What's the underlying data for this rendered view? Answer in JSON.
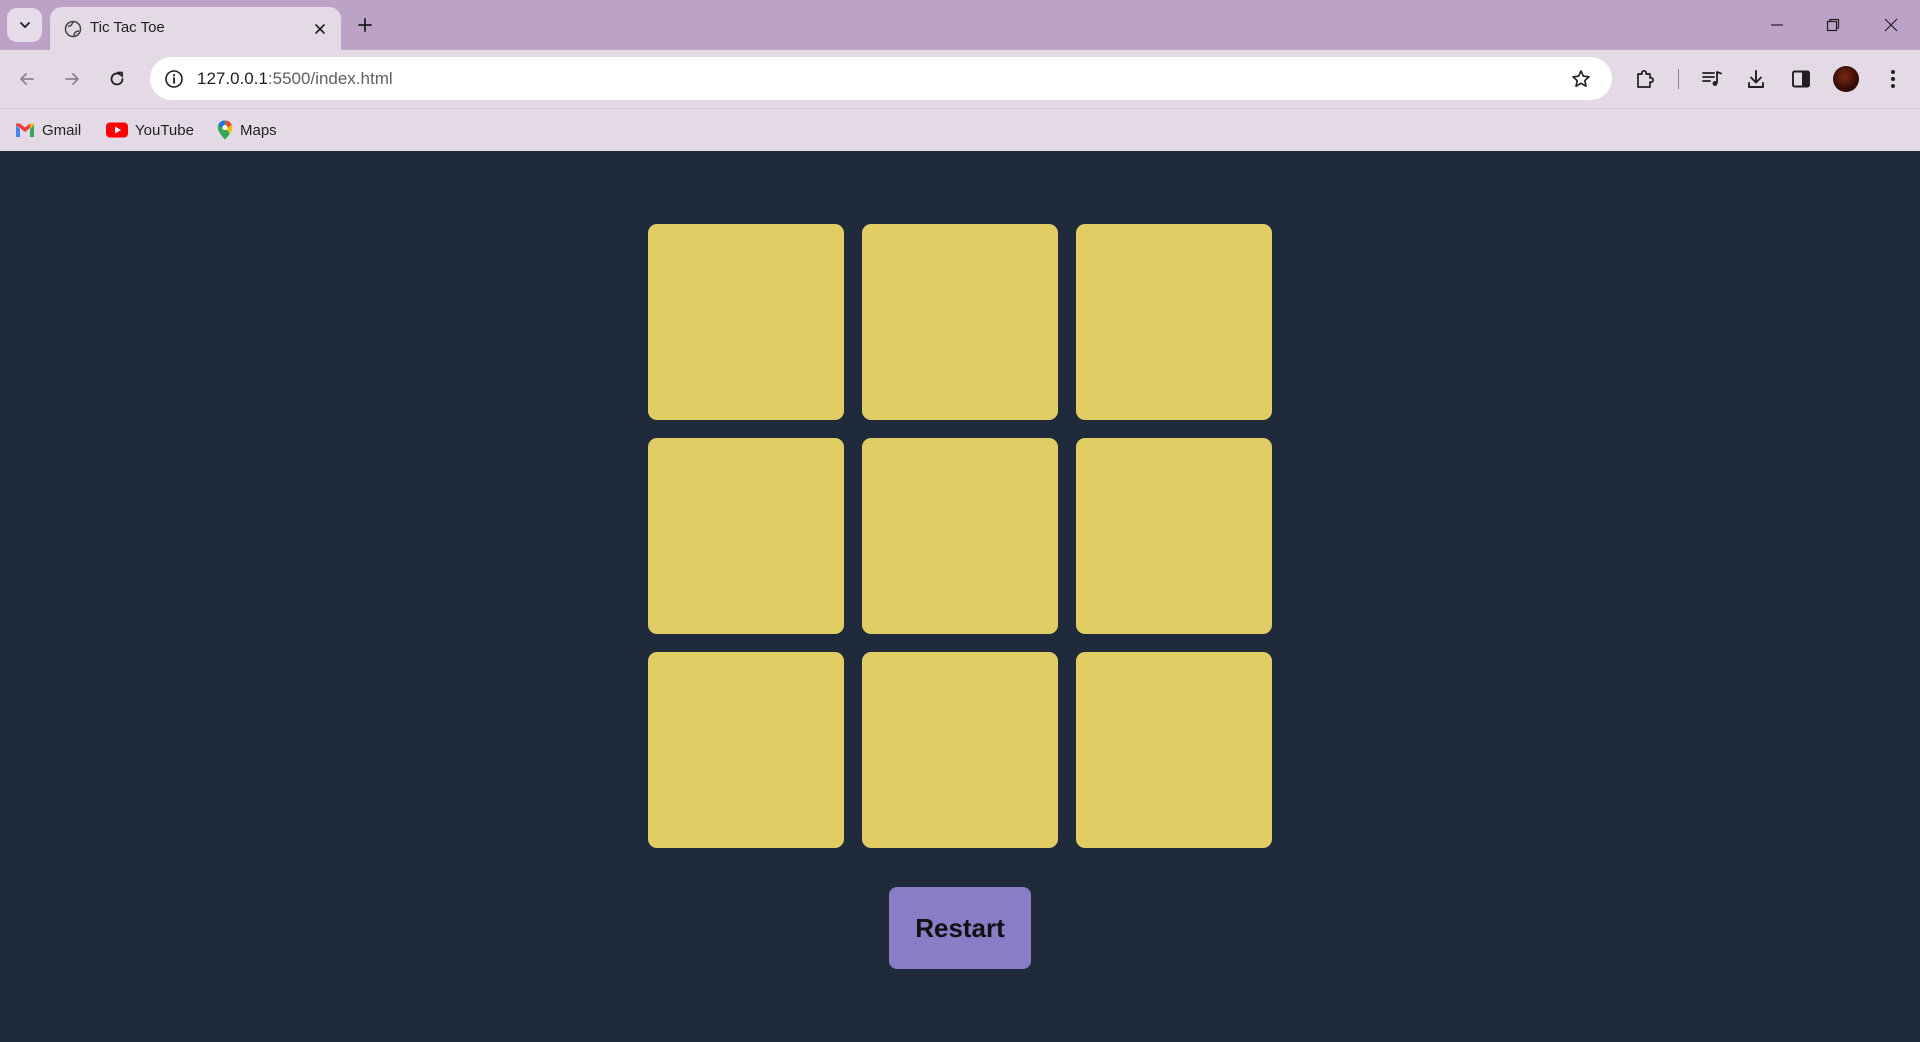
{
  "browser": {
    "tab": {
      "title": "Tic Tac Toe"
    },
    "address": {
      "host": "127.0.0.1",
      "path": ":5500/index.html"
    },
    "bookmarks": [
      {
        "label": "Gmail"
      },
      {
        "label": "YouTube"
      },
      {
        "label": "Maps"
      }
    ]
  },
  "game": {
    "cells": [
      "",
      "",
      "",
      "",
      "",
      "",
      "",
      "",
      ""
    ],
    "restart_label": "Restart"
  },
  "colors": {
    "page_background": "#1f2a3a",
    "cell": "#e1cd64",
    "restart_button": "#8b7cc8",
    "browser_frame": "#bca2c6"
  }
}
